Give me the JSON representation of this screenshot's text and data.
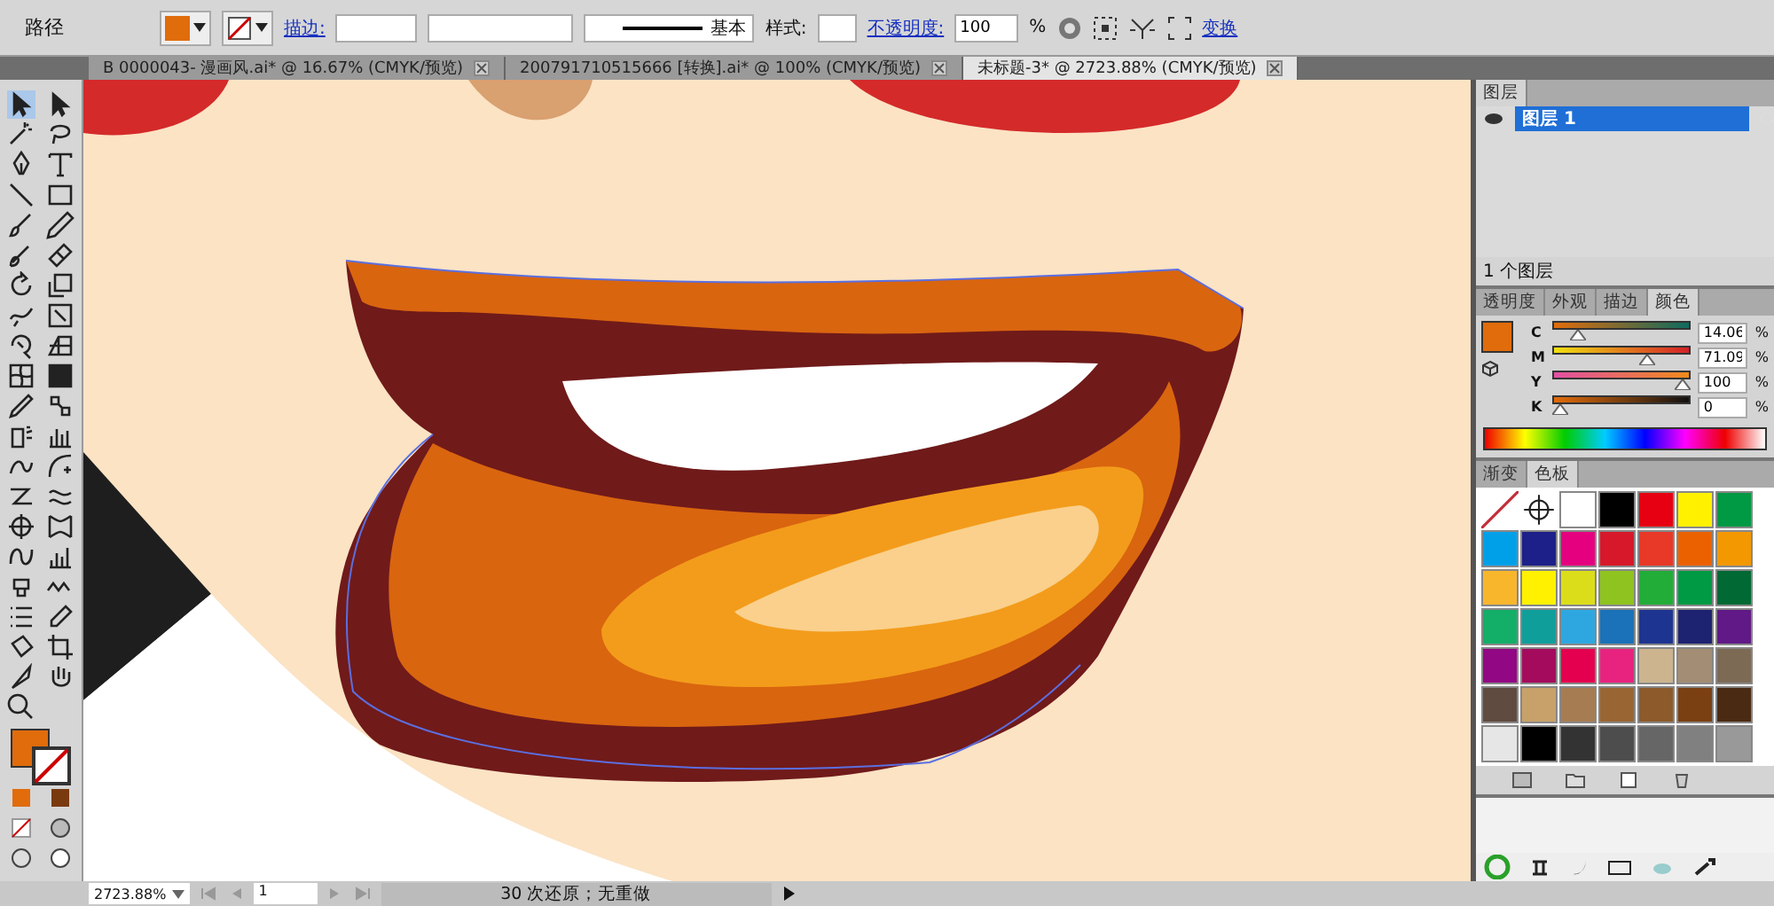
{
  "control_bar": {
    "object_label": "路径",
    "fill": {
      "color": "#e06c0c"
    },
    "stroke_label": "描边:",
    "stroke_profile": "基本",
    "style_label": "样式:",
    "opacity_label": "不透明度:",
    "opacity_value": "100",
    "opacity_unit": "%",
    "transform_link": "变换"
  },
  "document_tabs": [
    {
      "label": "B 0000043-  漫画风.ai* @ 16.67% (CMYK/预览)",
      "selected": false
    },
    {
      "label": "200791710515666  [转换].ai* @ 100% (CMYK/预览)",
      "selected": false
    },
    {
      "label": "未标题-3* @ 2723.88% (CMYK/预览)",
      "selected": true
    }
  ],
  "layers_panel": {
    "tab": "图层",
    "layers": [
      {
        "name": "图层 1",
        "selected": true
      }
    ],
    "footer": "1 个图层"
  },
  "color_panel": {
    "tabs": [
      {
        "label": "透明度",
        "selected": false
      },
      {
        "label": "外观",
        "selected": false
      },
      {
        "label": "描边",
        "selected": false
      },
      {
        "label": "颜色",
        "selected": true
      }
    ],
    "fill": {
      "color": "#e06c0c"
    },
    "channels": [
      {
        "name": "C",
        "level": 0.14,
        "value": "14.06",
        "unit": "%"
      },
      {
        "name": "M",
        "level": 0.71,
        "value": "71.09",
        "unit": "%"
      },
      {
        "name": "Y",
        "level": 1,
        "value": "100",
        "unit": "%"
      },
      {
        "name": "K",
        "level": 0,
        "value": "0",
        "unit": "%"
      }
    ]
  },
  "swatches_panel": {
    "tabs": [
      {
        "label": "渐变",
        "selected": false
      },
      {
        "label": "色板",
        "selected": true
      }
    ],
    "swatches": [
      {
        "kind": "none"
      },
      {
        "kind": "registration"
      },
      {
        "kind": "color",
        "color": "#ffffff"
      },
      {
        "kind": "color",
        "color": "#000000"
      },
      {
        "kind": "color",
        "color": "#e60012"
      },
      {
        "kind": "color",
        "color": "#fff100"
      },
      {
        "kind": "color",
        "color": "#009944"
      },
      {
        "kind": "color",
        "color": "#00a0e9"
      },
      {
        "kind": "color",
        "color": "#1d2088"
      },
      {
        "kind": "color",
        "color": "#e4007f"
      },
      {
        "kind": "color",
        "color": "#d7182a"
      },
      {
        "kind": "color",
        "color": "#e83828"
      },
      {
        "kind": "color",
        "color": "#eb6100"
      },
      {
        "kind": "color",
        "color": "#f39800"
      },
      {
        "kind": "color",
        "color": "#f8b62d"
      },
      {
        "kind": "color",
        "color": "#fff100"
      },
      {
        "kind": "color",
        "color": "#dcdd1a"
      },
      {
        "kind": "color",
        "color": "#8fc31f"
      },
      {
        "kind": "color",
        "color": "#22ac38"
      },
      {
        "kind": "color",
        "color": "#009944"
      },
      {
        "kind": "color",
        "color": "#006934"
      },
      {
        "kind": "color",
        "color": "#13ae67"
      },
      {
        "kind": "color",
        "color": "#109e9a"
      },
      {
        "kind": "color",
        "color": "#2ea7e0"
      },
      {
        "kind": "color",
        "color": "#1b72b8"
      },
      {
        "kind": "color",
        "color": "#1d3590"
      },
      {
        "kind": "color",
        "color": "#1d2271"
      },
      {
        "kind": "color",
        "color": "#601986"
      },
      {
        "kind": "color",
        "color": "#920783"
      },
      {
        "kind": "color",
        "color": "#a40b5d"
      },
      {
        "kind": "color",
        "color": "#e4004f"
      },
      {
        "kind": "color",
        "color": "#e8237f"
      },
      {
        "kind": "color",
        "color": "#cbb48e"
      },
      {
        "kind": "color",
        "color": "#a38d74"
      },
      {
        "kind": "color",
        "color": "#7d6a55"
      },
      {
        "kind": "color",
        "color": "#5f4b3f"
      },
      {
        "kind": "color",
        "color": "#c7a06a"
      },
      {
        "kind": "color",
        "color": "#a67c52"
      },
      {
        "kind": "color",
        "color": "#996633"
      },
      {
        "kind": "color",
        "color": "#8c5a2b"
      },
      {
        "kind": "color",
        "color": "#7a4011"
      },
      {
        "kind": "color",
        "color": "#4a2a12"
      },
      {
        "kind": "color",
        "color": "#e6e6e6"
      },
      {
        "kind": "color",
        "color": "#000000"
      },
      {
        "kind": "color",
        "color": "#333333"
      },
      {
        "kind": "color",
        "color": "#4d4d4d"
      },
      {
        "kind": "color",
        "color": "#666666"
      },
      {
        "kind": "color",
        "color": "#808080"
      },
      {
        "kind": "color",
        "color": "#999999"
      }
    ]
  },
  "status_bar": {
    "zoom": "2723.88%",
    "page": "1",
    "message": "30 次还原；无重做"
  }
}
